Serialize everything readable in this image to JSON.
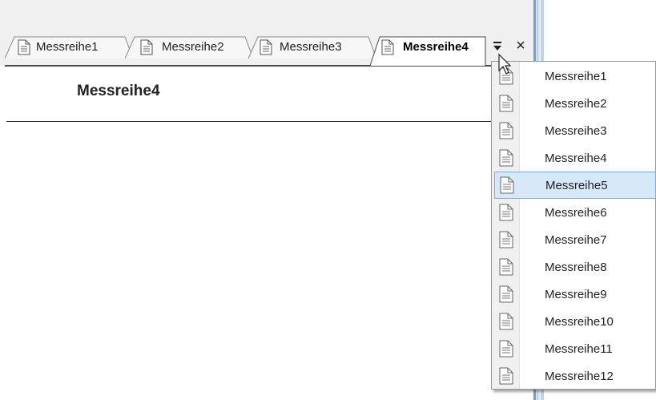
{
  "tabs": [
    {
      "label": "Messreihe1",
      "active": false
    },
    {
      "label": "Messreihe2",
      "active": false
    },
    {
      "label": "Messreihe3",
      "active": false
    },
    {
      "label": "Messreihe4",
      "active": true
    }
  ],
  "tab_overflow_icon": "chevron-down-list-icon",
  "close_label": "×",
  "document": {
    "title": "Messreihe4"
  },
  "menu": {
    "items": [
      {
        "label": "Messreihe1",
        "icon": "document-icon"
      },
      {
        "label": "Messreihe2",
        "icon": "document-icon"
      },
      {
        "label": "Messreihe3",
        "icon": "document-icon"
      },
      {
        "label": "Messreihe4",
        "icon": "document-icon"
      },
      {
        "label": "Messreihe5",
        "icon": "document-icon",
        "highlighted": true
      },
      {
        "label": "Messreihe6",
        "icon": "document-icon"
      },
      {
        "label": "Messreihe7",
        "icon": "document-icon"
      },
      {
        "label": "Messreihe8",
        "icon": "document-icon"
      },
      {
        "label": "Messreihe9",
        "icon": "document-icon"
      },
      {
        "label": "Messreihe10",
        "icon": "document-icon"
      },
      {
        "label": "Messreihe11",
        "icon": "document-icon"
      },
      {
        "label": "Messreihe12",
        "icon": "document-icon"
      }
    ]
  },
  "colors": {
    "menu_highlight": "#d7e9f9",
    "menu_highlight_border": "#84acd8",
    "frame_blue": "#7f9db9"
  }
}
